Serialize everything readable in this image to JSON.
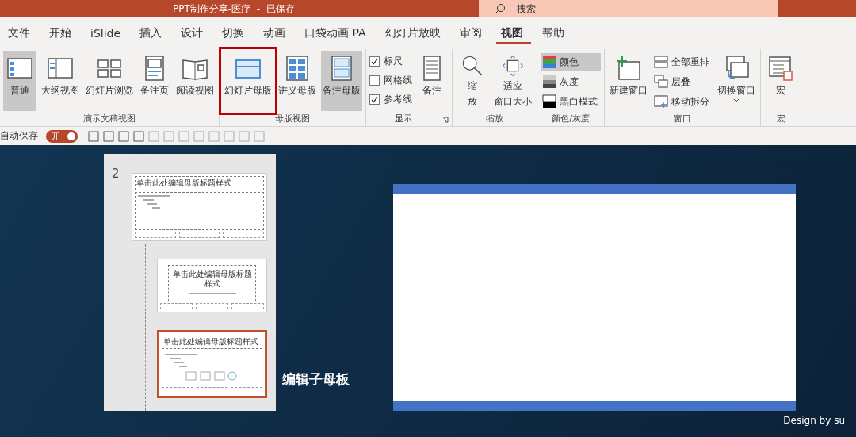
{
  "window": {
    "title": "PPT制作分享-医疗  -  已保存",
    "search_placeholder": "搜索"
  },
  "tabs": [
    {
      "label": "文件",
      "selected": false
    },
    {
      "label": "开始",
      "selected": false
    },
    {
      "label": "iSlide",
      "selected": false
    },
    {
      "label": "插入",
      "selected": false
    },
    {
      "label": "设计",
      "selected": false
    },
    {
      "label": "切换",
      "selected": false
    },
    {
      "label": "动画",
      "selected": false
    },
    {
      "label": "口袋动画 PA",
      "selected": false
    },
    {
      "label": "幻灯片放映",
      "selected": false
    },
    {
      "label": "审阅",
      "selected": false
    },
    {
      "label": "视图",
      "selected": true
    },
    {
      "label": "帮助",
      "selected": false
    }
  ],
  "ribbon_groups": [
    {
      "label": "演示文稿视图",
      "items": [
        {
          "kind": "large",
          "lines": [
            "普通"
          ],
          "selected": true,
          "highlight": false
        },
        {
          "kind": "large",
          "lines": [
            "大纲视图"
          ],
          "selected": false,
          "highlight": false
        },
        {
          "kind": "large",
          "lines": [
            "幻灯片浏览"
          ],
          "selected": false,
          "highlight": false
        },
        {
          "kind": "large",
          "lines": [
            "备注页"
          ],
          "selected": false,
          "highlight": false
        },
        {
          "kind": "large",
          "lines": [
            "阅读视图"
          ],
          "selected": false,
          "highlight": false
        }
      ]
    },
    {
      "label": "母版视图",
      "items": [
        {
          "kind": "large",
          "lines": [
            "幻灯片母版"
          ],
          "selected": false,
          "highlight": true
        },
        {
          "kind": "large",
          "lines": [
            "讲义母版"
          ],
          "selected": false,
          "highlight": false
        },
        {
          "kind": "large",
          "lines": [
            "备注母版"
          ],
          "selected": true,
          "highlight": false
        }
      ]
    },
    {
      "label": "显示",
      "launcher": true,
      "items": [
        {
          "kind": "checks",
          "checks": [
            {
              "label": "标尺",
              "checked": true
            },
            {
              "label": "网格线",
              "checked": false
            },
            {
              "label": "参考线",
              "checked": true
            }
          ]
        },
        {
          "kind": "large",
          "lines": [
            "备注"
          ],
          "selected": false
        }
      ]
    },
    {
      "label": "缩放",
      "items": [
        {
          "kind": "large",
          "lines": [
            "缩",
            "放"
          ],
          "selected": false
        },
        {
          "kind": "large",
          "lines": [
            "适应",
            "窗口大小"
          ],
          "selected": false
        }
      ]
    },
    {
      "label": "颜色/灰度",
      "items": [
        {
          "kind": "smalls",
          "smalls": [
            {
              "label": "颜色",
              "selected": true
            },
            {
              "label": "灰度",
              "selected": false
            },
            {
              "label": "黑白模式",
              "selected": false
            }
          ]
        }
      ]
    },
    {
      "label": "窗口",
      "items": [
        {
          "kind": "large",
          "lines": [
            "新建窗口"
          ],
          "selected": false
        },
        {
          "kind": "smalls",
          "smalls": [
            {
              "label": "全部重排",
              "selected": false
            },
            {
              "label": "层叠",
              "selected": false
            },
            {
              "label": "移动拆分",
              "selected": false
            }
          ]
        },
        {
          "kind": "large",
          "lines": [
            "切换窗口"
          ],
          "selected": false,
          "dropdown": true
        }
      ]
    },
    {
      "label": "宏",
      "items": [
        {
          "kind": "large",
          "lines": [
            "宏"
          ],
          "selected": false
        }
      ]
    }
  ],
  "quick_access": {
    "autosave_label": "自动保存",
    "autosave_on": true,
    "autosave_state": "开"
  },
  "thumbnail_panel": {
    "number": "2",
    "thumbnails": [
      {
        "kind": "master",
        "title": "单击此处编辑母版标题样式",
        "selected": false
      },
      {
        "kind": "title",
        "title": "单击此处编辑母版标题样式",
        "selected": false
      },
      {
        "kind": "content",
        "title": "单击此处编辑母版标题样式",
        "selected": true
      }
    ]
  },
  "caption": "编辑子母板",
  "credit": "Design by su"
}
